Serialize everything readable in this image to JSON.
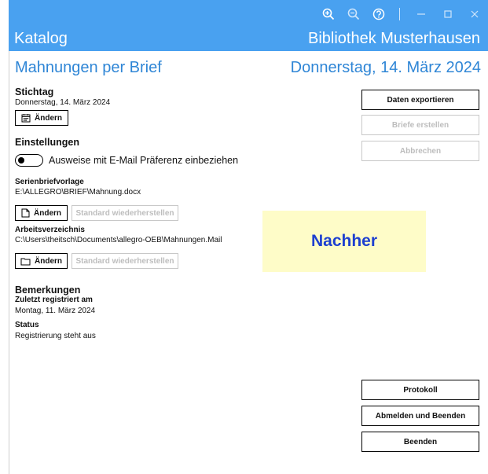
{
  "app": {
    "left_title": "Katalog",
    "right_title": "Bibliothek Musterhausen"
  },
  "page": {
    "title": "Mahnungen per Brief",
    "date": "Donnerstag, 14. März 2024"
  },
  "stichtag": {
    "heading": "Stichtag",
    "value": "Donnerstag, 14. März 2024",
    "change_label": "Ändern"
  },
  "einstellungen": {
    "heading": "Einstellungen",
    "toggle_label": "Ausweise mit E-Mail Präferenz einbeziehen",
    "toggle_on": false
  },
  "serienbrief": {
    "label": "Serienbriefvorlage",
    "path": "E:\\ALLEGRO\\BRIEF\\Mahnung.docx",
    "change_label": "Ändern",
    "reset_label": "Standard wiederherstellen"
  },
  "arbeitsverzeichnis": {
    "label": "Arbeitsverzeichnis",
    "path": "C:\\Users\\theitsch\\Documents\\allegro-OEB\\Mahnungen.Mail",
    "change_label": "Ändern",
    "reset_label": "Standard wiederherstellen"
  },
  "bemerkungen": {
    "heading": "Bemerkungen",
    "registered_label": "Zuletzt registriert am",
    "registered_value": "Montag, 11. März 2024",
    "status_label": "Status",
    "status_value": "Registrierung steht aus"
  },
  "overlay": {
    "text": "Nachher"
  },
  "actions": {
    "export": "Daten exportieren",
    "create_letters": "Briefe erstellen",
    "cancel": "Abbrechen",
    "protocol": "Protokoll",
    "logout_exit": "Abmelden und Beenden",
    "exit": "Beenden"
  },
  "colors": {
    "titlebar": "#49a1f0",
    "heading_blue": "#2f86d6",
    "overlay_bg": "#fefcc8",
    "overlay_text": "#1d3fd0"
  },
  "icons": [
    "zoom-in-icon",
    "zoom-out-icon",
    "help-icon",
    "minimize-icon",
    "maximize-icon",
    "close-icon",
    "calendar-icon",
    "document-icon",
    "folder-icon"
  ]
}
